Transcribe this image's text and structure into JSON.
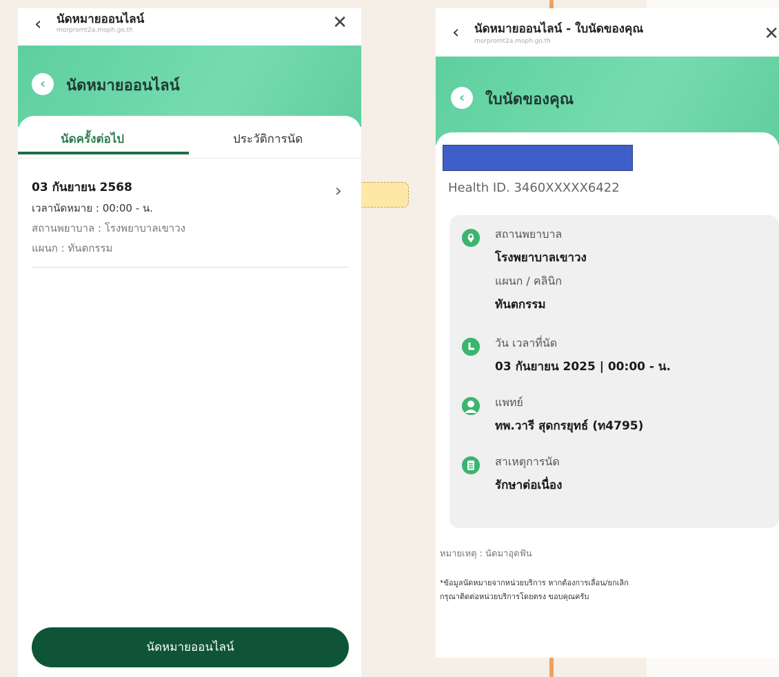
{
  "left": {
    "topbar": {
      "title": "นัดหมายออนไลน์",
      "url": "morpromt2a.moph.go.th",
      "back_icon": "‹",
      "close_icon": "✕"
    },
    "header": {
      "title": "นัดหมายออนไลน์",
      "back_icon": "‹"
    },
    "tabs": [
      {
        "label": "นัดครั้งต่อไป"
      },
      {
        "label": "ประวัติการนัด"
      }
    ],
    "appointment": {
      "date": "03 กันยายน 2568",
      "time": "เวลานัดหมาย : 00:00 - น.",
      "hospital": "สถานพยาบาล : โรงพยาบาลเขาวง",
      "department": "แผนก : ทันตกรรม",
      "chevron": "›"
    },
    "bottom_button": "นัดหมายออนไลน์"
  },
  "right": {
    "topbar": {
      "title": "นัดหมายออนไลน์ - ใบนัดของคุณ",
      "url": "morpromt2a.moph.go.th",
      "back_icon": "‹",
      "close_icon": "✕"
    },
    "header": {
      "title": "ใบนัดของคุณ",
      "back_icon": "‹"
    },
    "health_id": "Health ID. 3460XXXXX6422",
    "details": {
      "hospital_label": "สถานพยาบาล",
      "hospital_value": "โรงพยาบาลเขาวง",
      "department_label": "แผนก / คลินิก",
      "department_value": "ทันตกรรม",
      "datetime_label": "วัน เวลาที่นัด",
      "datetime_value": "03 กันยายน 2025 | 00:00 - น.",
      "doctor_label": "แพทย์",
      "doctor_value": "ทพ.วารี สุดกรยุทธ์ (ท4795)",
      "reason_label": "สาเหตุการนัด",
      "reason_value": "รักษาต่อเนื่อง"
    },
    "icons": {
      "hospital": "location-pin-icon",
      "datetime": "clock-icon",
      "doctor": "doctor-icon",
      "reason": "clipboard-icon"
    },
    "remark": "หมายเหตุ : นัดมาอุดฟัน",
    "footnote_line1": "*ข้อมูลนัดหมายจากหน่วยบริการ หากต้องการเลื่อน/ยกเลิก",
    "footnote_line2": "กรุณาติดต่อหน่วยบริการโดยตรง ขอบคุณครับ"
  },
  "colors": {
    "primary_green": "#0f5436",
    "accent_green": "#2f7d52",
    "header_green": "#6dd5a8",
    "redaction_blue": "#3f5fc8"
  }
}
